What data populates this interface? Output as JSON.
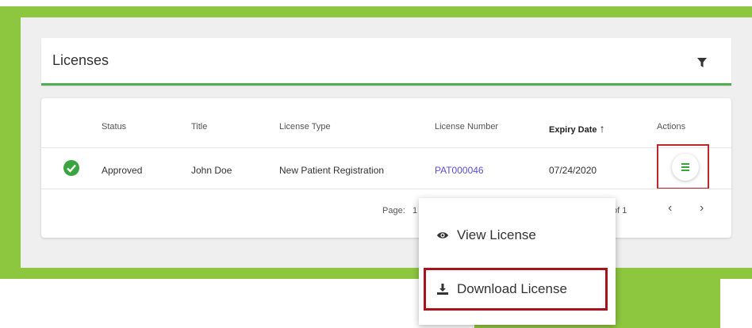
{
  "header": {
    "title": "Licenses",
    "filter_icon": "filter-icon"
  },
  "table": {
    "columns": [
      "Status",
      "Title",
      "License Type",
      "License Number",
      "Expiry Date",
      "Actions"
    ],
    "sort_indicator": "↑",
    "rows": [
      {
        "status": "Approved",
        "title": "John Doe",
        "license_type": "New Patient Registration",
        "license_number": "PAT000046",
        "expiry_date": "07/24/2020"
      }
    ]
  },
  "pagination": {
    "page_label": "Page:",
    "page_value": "1",
    "of_label": "of 1",
    "prev": "‹",
    "next": "›"
  },
  "menu": {
    "items": [
      {
        "label": "View License",
        "icon": "eye-icon"
      },
      {
        "label": "Download License",
        "icon": "download-icon"
      }
    ]
  },
  "colors": {
    "accent_green": "#8dc63f",
    "header_underline": "#4caf50",
    "link": "#5b4cd6",
    "highlight": "#c0272d"
  }
}
